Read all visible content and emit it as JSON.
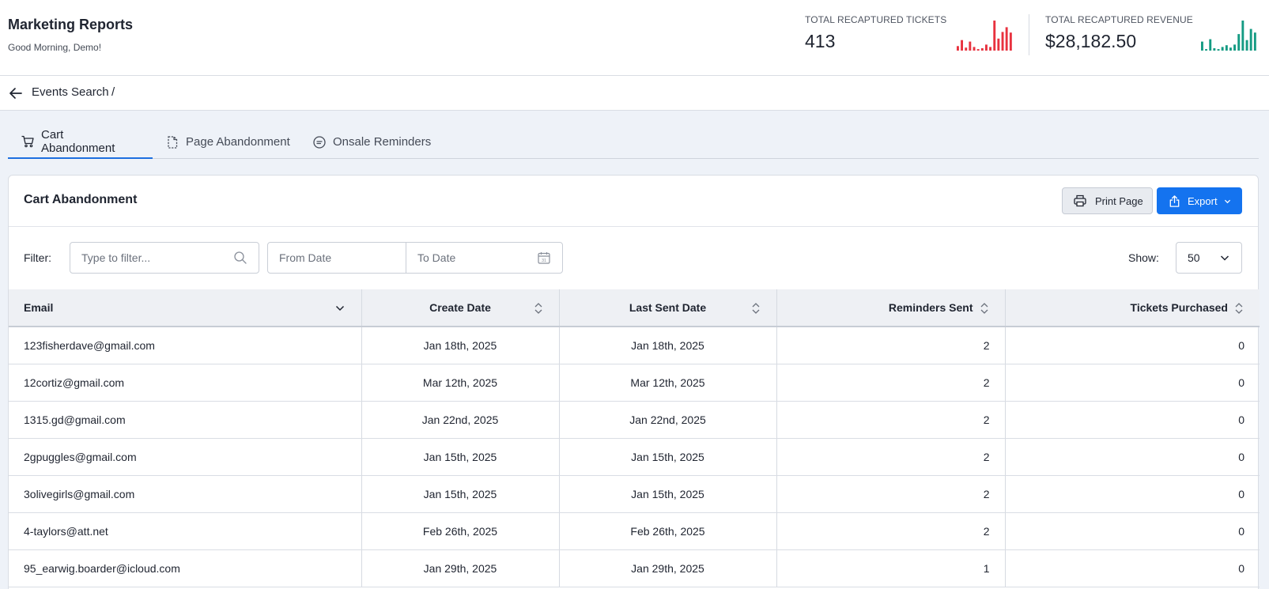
{
  "header": {
    "title": "Marketing Reports",
    "greeting": "Good Morning, Demo!",
    "stats": [
      {
        "label": "TOTAL RECAPTURED TICKETS",
        "value": "413",
        "color": "#e8323f",
        "spark": [
          0.15,
          0.35,
          0.1,
          0.3,
          0.12,
          0.05,
          0.08,
          0.2,
          0.12,
          1.0,
          0.4,
          0.62,
          0.78,
          0.6
        ]
      },
      {
        "label": "TOTAL RECAPTURED REVENUE",
        "value": "$28,182.50",
        "color": "#149b83",
        "spark": [
          0.3,
          0.05,
          0.38,
          0.08,
          0.05,
          0.12,
          0.18,
          0.1,
          0.2,
          0.55,
          1.0,
          0.35,
          0.72,
          0.6
        ]
      }
    ]
  },
  "breadcrumb": {
    "current": "Events Search",
    "separator": "/"
  },
  "tabs": [
    {
      "label": "Cart Abandonment",
      "icon": "cart-icon",
      "active": true
    },
    {
      "label": "Page Abandonment",
      "icon": "page-icon",
      "active": false
    },
    {
      "label": "Onsale Reminders",
      "icon": "chat-icon",
      "active": false
    }
  ],
  "card": {
    "title": "Cart Abandonment",
    "print_label": "Print Page",
    "export_label": "Export"
  },
  "filter": {
    "label": "Filter:",
    "placeholder": "Type to filter...",
    "from_date": "From Date",
    "to_date": "To Date",
    "show_label": "Show:",
    "show_value": "50"
  },
  "table": {
    "columns": [
      "Email",
      "Create Date",
      "Last Sent Date",
      "Reminders Sent",
      "Tickets Purchased"
    ],
    "rows": [
      [
        "123fisherdave@gmail.com",
        "Jan 18th, 2025",
        "Jan 18th, 2025",
        "2",
        "0"
      ],
      [
        "12cortiz@gmail.com",
        "Mar 12th, 2025",
        "Mar 12th, 2025",
        "2",
        "0"
      ],
      [
        "1315.gd@gmail.com",
        "Jan 22nd, 2025",
        "Jan 22nd, 2025",
        "2",
        "0"
      ],
      [
        "2gpuggles@gmail.com",
        "Jan 15th, 2025",
        "Jan 15th, 2025",
        "2",
        "0"
      ],
      [
        "3olivegirls@gmail.com",
        "Jan 15th, 2025",
        "Jan 15th, 2025",
        "2",
        "0"
      ],
      [
        "4-taylors@att.net",
        "Feb 26th, 2025",
        "Feb 26th, 2025",
        "2",
        "0"
      ],
      [
        "95_earwig.boarder@icloud.com",
        "Jan 29th, 2025",
        "Jan 29th, 2025",
        "1",
        "0"
      ]
    ]
  }
}
